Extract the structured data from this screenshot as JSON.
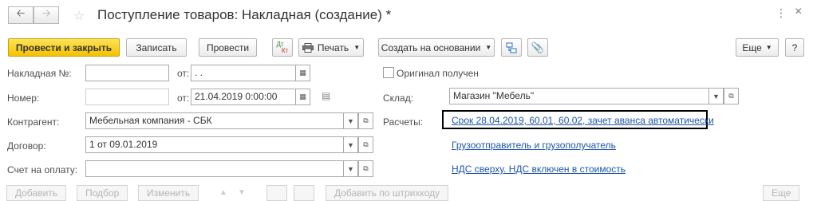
{
  "window": {
    "title": "Поступление товаров: Накладная (создание) *",
    "back_icon": "arrow-left-icon",
    "forward_icon": "arrow-right-icon",
    "menu_icon": "more-vertical-icon",
    "close_icon": "close-icon"
  },
  "toolbar": {
    "post_and_close": "Провести и закрыть",
    "save": "Записать",
    "post": "Провести",
    "dt_kt_top": "Дт",
    "dt_kt_bottom": "Кт",
    "print": "Печать",
    "create_based_on": "Создать на основании",
    "more": "Еще",
    "help": "?"
  },
  "form": {
    "invoice_no_label": "Накладная №:",
    "invoice_no_value": "",
    "invoice_from_label": "от:",
    "invoice_date_value": " .  .",
    "number_label": "Номер:",
    "number_value": "",
    "number_from_label": "от:",
    "number_date_value": "21.04.2019  0:00:00",
    "original_received_label": "Оригинал получен",
    "warehouse_label": "Склад:",
    "warehouse_value": "Магазин \"Мебель\"",
    "counterparty_label": "Контрагент:",
    "counterparty_value": "Мебельная компания - СБК",
    "settlements_label": "Расчеты:",
    "settlements_link": "Срок 28.04.2019, 60.01, 60.02, зачет аванса автоматически",
    "contract_label": "Договор:",
    "contract_value": "1 от 09.01.2019",
    "shipper_link": "Грузоотправитель и грузополучатель",
    "payment_invoice_label": "Счет на оплату:",
    "payment_invoice_value": "",
    "vat_link": "НДС сверху. НДС включен в стоимость"
  },
  "table_toolbar": {
    "add": "Добавить",
    "pick": "Подбор",
    "change": "Изменить",
    "add_by_barcode": "Добавить по штрихкоду",
    "more": "Еще"
  },
  "colors": {
    "primary_button": "#f4c200",
    "link": "#1d56a8",
    "highlight_border": "#000000"
  }
}
